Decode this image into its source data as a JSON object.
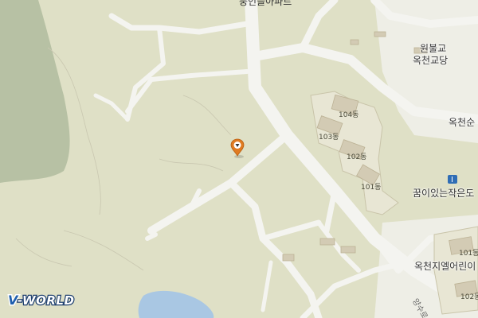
{
  "map": {
    "top_label_partial": "풍인들아파트",
    "poi": {
      "church_line1": "원불교",
      "church_line2": "옥천교당",
      "okcheon_partial": "옥천순",
      "library_partial": "꿈이있는작은도",
      "apartment_partial": "옥천지엘어린이"
    },
    "buildings": [
      "104동",
      "103동",
      "102동",
      "101동",
      "101동",
      "102동"
    ],
    "road_label_partial": "양수로"
  },
  "marker": {
    "name": "location-marker"
  },
  "logo": {
    "text_v": "V",
    "text_rest": "-WORLD"
  },
  "colors": {
    "land": "#dfe0c6",
    "road": "#f3f3ef",
    "forest": "#b6c0a3",
    "water": "#a9c7e3",
    "apartment": "#e9e7d6",
    "marker": "#e07b21"
  }
}
